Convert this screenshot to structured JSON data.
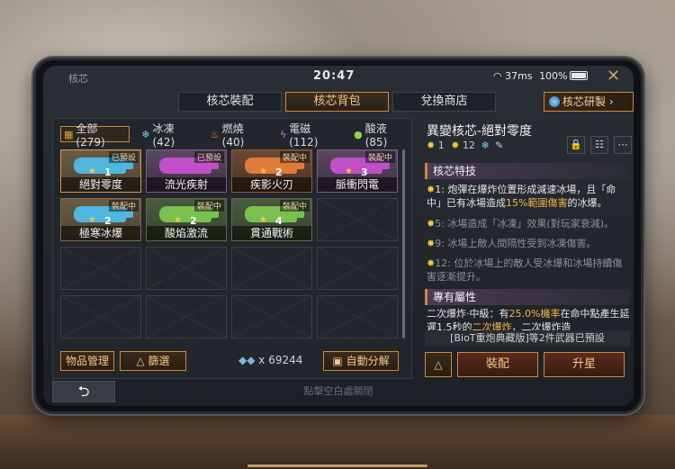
{
  "window": {
    "title": "核芯"
  },
  "status": {
    "time": "20:47",
    "network": "37ms",
    "battery": "100%"
  },
  "tabs": [
    {
      "label": "核芯裝配"
    },
    {
      "label": "核芯背包"
    },
    {
      "label": "兌換商店"
    }
  ],
  "research_button": "核芯研製",
  "filters": [
    {
      "label": "全部(279)",
      "icon": "grid-icon"
    },
    {
      "label": "冰凍(42)",
      "icon": "snowflake-icon"
    },
    {
      "label": "燃燒(40)",
      "icon": "flame-icon"
    },
    {
      "label": "電磁(112)",
      "icon": "lightning-icon"
    },
    {
      "label": "酸液(85)",
      "icon": "acid-drop-icon"
    }
  ],
  "cores": [
    {
      "name": "絕對零度",
      "badge": "已預設",
      "level": "1",
      "color": "#4fb6e0"
    },
    {
      "name": "流光疾射",
      "badge": "已預設",
      "level": "",
      "color": "#c04fc8"
    },
    {
      "name": "疾影火刃",
      "badge": "裝配中",
      "level": "2",
      "color": "#e07a3a"
    },
    {
      "name": "脈衝閃電",
      "badge": "裝配中",
      "level": "3",
      "color": "#c04fc8"
    },
    {
      "name": "極寒冰爆",
      "badge": "裝配中",
      "level": "2",
      "color": "#4fb6e0"
    },
    {
      "name": "酸焰激流",
      "badge": "裝配中",
      "level": "2",
      "color": "#7ac04f"
    },
    {
      "name": "貫通戰術",
      "badge": "裝配中",
      "level": "4",
      "color": "#7ac04f"
    }
  ],
  "bottom_left": {
    "manage": "物品管理",
    "filter": "篩選",
    "currency": "x 69244",
    "auto_decompose": "自動分解"
  },
  "detail": {
    "title": "異變核芯-絕對零度",
    "sub1": "1",
    "sub2": "12",
    "section1": "核芯特技",
    "desc1_a": "1: 炮彈在爆炸位置形成減速冰場，且「命中」已有冰場造成",
    "desc1_b": "15%範圍傷害",
    "desc1_c": "的冰爆。",
    "desc2": "5: 冰場造成「冰凍」效果(對玩家衰減)。",
    "desc3": "9: 冰場上敵人間隔性受到冰凍傷害。",
    "desc4": "12: 位於冰場上的敵人受冰爆和冰場持續傷害逐漸提升。",
    "section2": "專有屬性",
    "desc5_a": "二次爆炸·中級：有",
    "desc5_b": "25.0%機率",
    "desc5_c": "在命中點產生延遲1.5秒的",
    "desc5_d": "二次爆炸",
    "desc5_e": "，二次爆炸造",
    "notice": "[BioT重炮典藏版]等2件武器已預設",
    "equip": "裝配",
    "upgrade": "升星"
  },
  "footer_hint": "點擊空白處關閉"
}
